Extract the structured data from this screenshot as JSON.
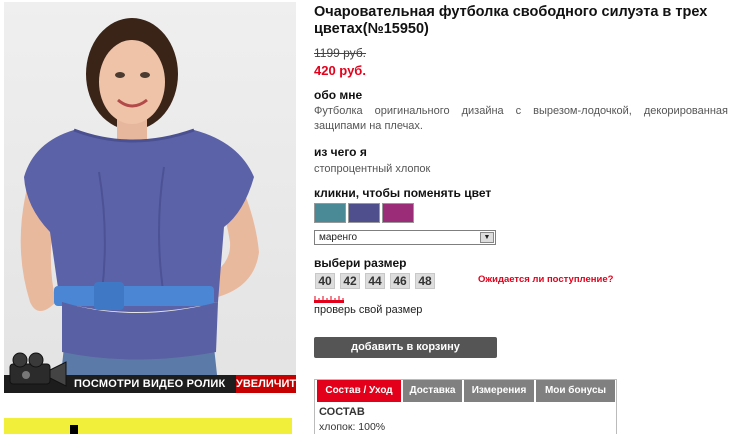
{
  "product": {
    "title": "Очаровательная футболка свободного силуэта в трех цветах(№15950)",
    "old_price": "1199 руб.",
    "new_price": "420 руб."
  },
  "about": {
    "heading": "обо мне",
    "text": "Футболка оригинального дизайна с вырезом-лодочкой, декорированная защипами на плечах."
  },
  "material": {
    "heading": "из чего я",
    "text": "стопроцентный хлопок"
  },
  "colors": {
    "heading": "кликни, чтобы поменять цвет",
    "swatches": [
      {
        "name": "teal",
        "color": "#4a8a96"
      },
      {
        "name": "navy",
        "color": "#4f4f8e"
      },
      {
        "name": "magenta",
        "color": "#9b2c78"
      }
    ],
    "selected": "маренго"
  },
  "sizes": {
    "heading": "выбери размер",
    "values": [
      "40",
      "42",
      "44",
      "46",
      "48"
    ],
    "notify_label": "Ожидается ли поступление?",
    "check_label": "проверь свой размер"
  },
  "cart": {
    "button_label": "добавить в корзину"
  },
  "photo": {
    "video_label": "ПОСМОТРИ ВИДЕО РОЛИК",
    "zoom_label": "УВЕЛИЧИТЬ",
    "accent_color": "#c60000"
  },
  "tabs": {
    "items": [
      "Состав / Уход",
      "Доставка",
      "Измерения",
      "Мои бонусы"
    ],
    "active_index": 0,
    "content_heading": "СОСТАВ",
    "content_text": "хлопок: 100%"
  }
}
